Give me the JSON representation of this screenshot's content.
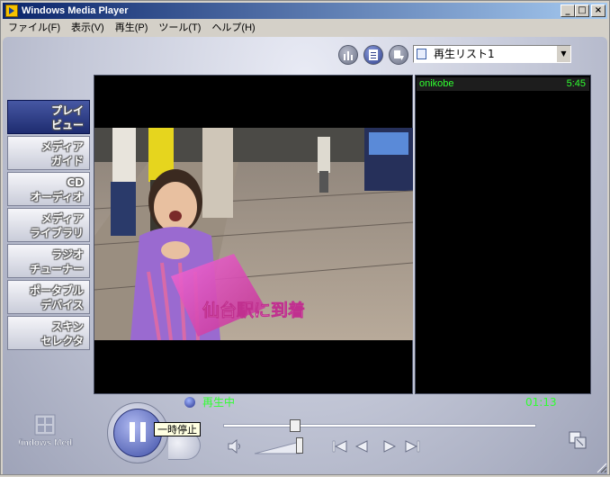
{
  "window": {
    "title": "Windows Media Player"
  },
  "menu": [
    "ファイル(F)",
    "表示(V)",
    "再生(P)",
    "ツール(T)",
    "ヘルプ(H)"
  ],
  "playlist_selector": {
    "value": "再生リスト1"
  },
  "sidebar": {
    "items": [
      {
        "line1": "プレイ",
        "line2": "ビュー",
        "active": true
      },
      {
        "line1": "メディア",
        "line2": "ガイド",
        "active": false
      },
      {
        "line1": "CD",
        "line2": "オーディオ",
        "active": false
      },
      {
        "line1": "メディア",
        "line2": "ライブラリ",
        "active": false
      },
      {
        "line1": "ラジオ",
        "line2": "チューナー",
        "active": false
      },
      {
        "line1": "ポータブル",
        "line2": "デバイス",
        "active": false
      },
      {
        "line1": "スキン",
        "line2": "セレクタ",
        "active": false
      }
    ]
  },
  "video": {
    "subtitle": "仙台駅に到着"
  },
  "playlist": {
    "items": [
      {
        "name": "onikobe",
        "duration": "5:45"
      }
    ]
  },
  "status": {
    "text": "再生中",
    "time": "01:13"
  },
  "controls": {
    "tooltip": "一時停止",
    "seek_fraction": 0.23,
    "volume_fraction": 0.9
  },
  "logo": "Windows Media",
  "colors": {
    "status_green": "#30ff30",
    "active_tab": "#2a3a86"
  }
}
